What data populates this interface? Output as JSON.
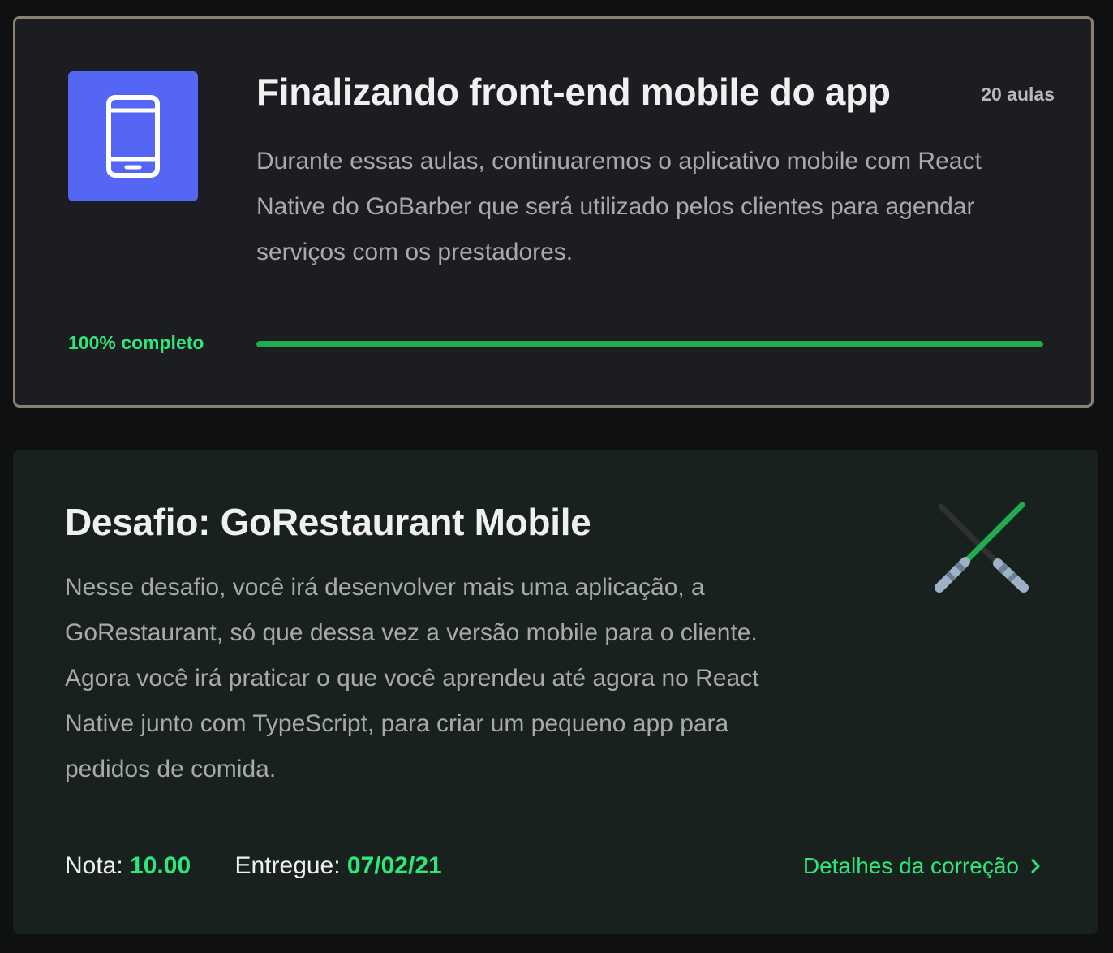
{
  "module": {
    "icon": "smartphone-icon",
    "icon_bg_color": "#5566f5",
    "title": "Finalizando front-end mobile do app",
    "lesson_count": "20 aulas",
    "description": "Durante essas aulas, continuaremos o aplicativo mobile com React Native do GoBarber que será utilizado pelos clientes para agendar serviços com os prestadores.",
    "progress_label": "100% completo",
    "progress_percent": 100,
    "progress_color": "#1fad4e"
  },
  "challenge": {
    "title": "Desafio: GoRestaurant Mobile",
    "description": "Nesse desafio, você irá desenvolver mais uma aplicação, a GoRestaurant, só que dessa vez a versão mobile para o cliente. Agora você irá praticar o que você aprendeu até agora no React Native junto com TypeScript, para criar um pequeno app para pedidos de comida.",
    "icon": "crossed-lightsabers-icon",
    "grade_label": "Nota:",
    "grade_value": "10.00",
    "delivered_label": "Entregue:",
    "delivered_value": "07/02/21",
    "details_link_label": "Detalhes da correção",
    "accent_color": "#2ee77b"
  }
}
